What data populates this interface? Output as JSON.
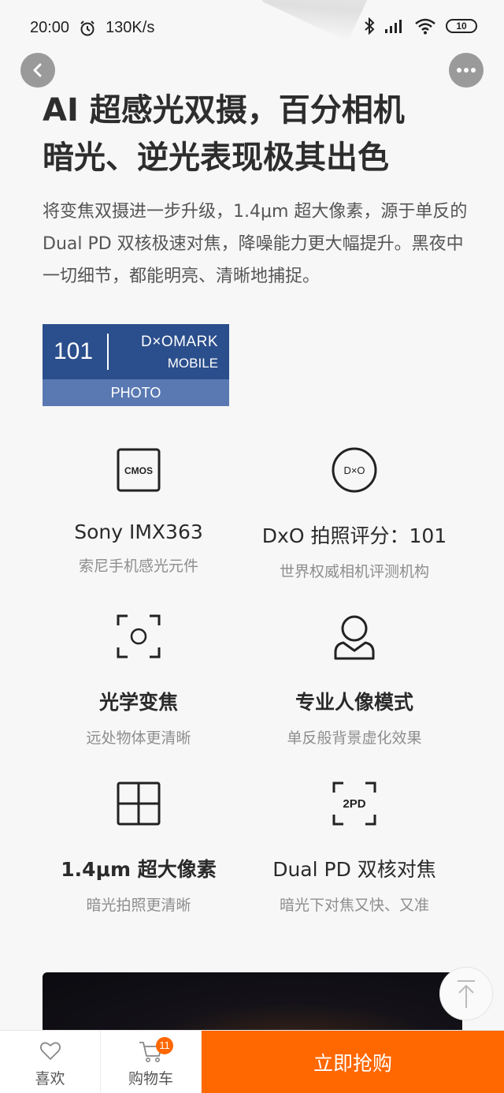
{
  "status_bar": {
    "time": "20:00",
    "speed": "130K/s",
    "battery": "10"
  },
  "headline": {
    "line1": "AI 超感光双摄，百分相机",
    "line2": "暗光、逆光表现极其出色"
  },
  "subtext": "将变焦双摄进一步升级，1.4μm 超大像素，源于单反的 Dual PD 双核极速对焦，降噪能力更大幅提升。黑夜中一切细节，都能明亮、清晰地捕捉。",
  "dxo_badge": {
    "score": "101",
    "brand": "D×OMARK",
    "category": "MOBILE",
    "subcategory": "PHOTO"
  },
  "features": [
    {
      "title": "Sony IMX363",
      "desc": "索尼手机感光元件",
      "icon": "cmos-icon",
      "icon_text": "CMOS"
    },
    {
      "title": "DxO 拍照评分：101",
      "desc": "世界权威相机评测机构",
      "icon": "dxo-icon",
      "icon_text": "D×O"
    },
    {
      "title": "光学变焦",
      "desc": "远处物体更清晰",
      "icon": "zoom-icon"
    },
    {
      "title": "专业人像模式",
      "desc": "单反般背景虚化效果",
      "icon": "portrait-icon"
    },
    {
      "title": "1.4μm 超大像素",
      "desc": "暗光拍照更清晰",
      "icon": "pixel-grid-icon"
    },
    {
      "title": "Dual PD 双核对焦",
      "desc": "暗光下对焦又快、又准",
      "icon": "dual-pd-icon",
      "icon_text": "2PD"
    }
  ],
  "bottom_bar": {
    "favorite_label": "喜欢",
    "cart_label": "购物车",
    "cart_count": "11",
    "buy_label": "立即抢购"
  },
  "colors": {
    "accent": "#ff6700",
    "dxo_dark": "#2b4e8c",
    "dxo_light": "#5a79b3"
  }
}
